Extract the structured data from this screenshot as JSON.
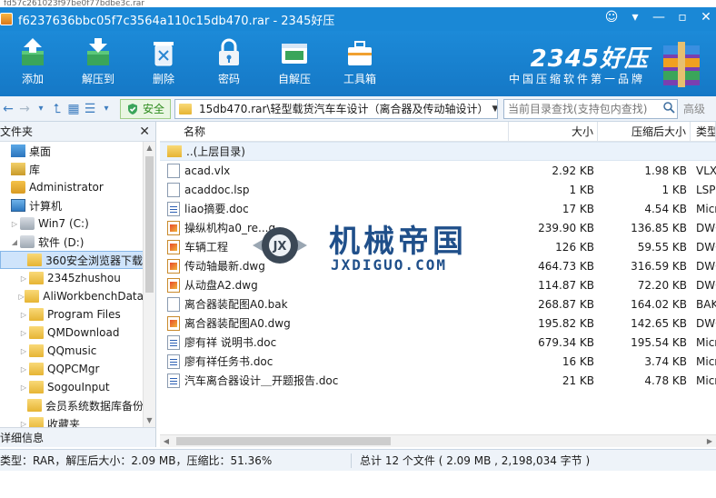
{
  "top_strip": "fd57c261023f97be0f77bdbe3c.rar",
  "window": {
    "title": "f6237636bbc05f7c3564a110c15db470.rar - 2345好压"
  },
  "toolbar": [
    {
      "label": "添加",
      "icon": "add-icon"
    },
    {
      "label": "解压到",
      "icon": "extract-icon"
    },
    {
      "label": "删除",
      "icon": "delete-icon"
    },
    {
      "label": "密码",
      "icon": "password-icon"
    },
    {
      "label": "自解压",
      "icon": "sfx-icon"
    },
    {
      "label": "工具箱",
      "icon": "toolbox-icon"
    }
  ],
  "brand": {
    "logo": "2345好压",
    "slogan": "中国压缩软件第一品牌"
  },
  "addressbar": {
    "safe_label": "安全",
    "path": "15db470.rar\\轻型载货汽车车设计（离合器及传动轴设计）",
    "search_placeholder": "当前目录查找(支持包内查找)",
    "advanced_label": "高级"
  },
  "left_pane": {
    "title": "文件夹",
    "close": "✕",
    "tree": [
      {
        "label": "桌面",
        "indent": 0,
        "icon": "desktop",
        "arrow": ""
      },
      {
        "label": "库",
        "indent": 0,
        "icon": "library",
        "arrow": ""
      },
      {
        "label": "Administrator",
        "indent": 0,
        "icon": "user",
        "arrow": ""
      },
      {
        "label": "计算机",
        "indent": 0,
        "icon": "computer",
        "arrow": ""
      },
      {
        "label": "Win7 (C:)",
        "indent": 1,
        "icon": "drive",
        "arrow": "▷"
      },
      {
        "label": "软件 (D:)",
        "indent": 1,
        "icon": "drive",
        "arrow": "◢"
      },
      {
        "label": "360安全浏览器下载",
        "indent": 2,
        "icon": "folder",
        "arrow": "",
        "selected": true
      },
      {
        "label": "2345zhushou",
        "indent": 2,
        "icon": "folder",
        "arrow": "▷"
      },
      {
        "label": "AliWorkbenchData",
        "indent": 2,
        "icon": "folder",
        "arrow": "▷"
      },
      {
        "label": "Program Files",
        "indent": 2,
        "icon": "folder",
        "arrow": "▷"
      },
      {
        "label": "QMDownload",
        "indent": 2,
        "icon": "folder",
        "arrow": "▷"
      },
      {
        "label": "QQmusic",
        "indent": 2,
        "icon": "folder",
        "arrow": "▷"
      },
      {
        "label": "QQPCMgr",
        "indent": 2,
        "icon": "folder",
        "arrow": "▷"
      },
      {
        "label": "SogouInput",
        "indent": 2,
        "icon": "folder",
        "arrow": "▷"
      },
      {
        "label": "会员系统数据库备份",
        "indent": 2,
        "icon": "folder",
        "arrow": ""
      },
      {
        "label": "收藏夹",
        "indent": 2,
        "icon": "folder",
        "arrow": "▷"
      }
    ]
  },
  "detail_pane_title": "详细信息",
  "file_list": {
    "columns": {
      "name": "名称",
      "size": "大小",
      "csize": "压缩后大小",
      "type": "类型"
    },
    "up_row": "..(上层目录)",
    "rows": [
      {
        "name": "acad.vlx",
        "size": "2.92 KB",
        "csize": "1.98 KB",
        "type": "VLX",
        "icon": "file"
      },
      {
        "name": "acaddoc.lsp",
        "size": "1 KB",
        "csize": "1 KB",
        "type": "LSP",
        "icon": "file"
      },
      {
        "name": "liao摘要.doc",
        "size": "17 KB",
        "csize": "4.54 KB",
        "type": "Micr",
        "icon": "doc"
      },
      {
        "name": "操纵机构a0_re...g",
        "size": "239.90 KB",
        "csize": "136.85 KB",
        "type": "DWG",
        "icon": "dwg"
      },
      {
        "name": "车辆工程",
        "size": "126 KB",
        "csize": "59.55 KB",
        "type": "DWG",
        "icon": "dwg"
      },
      {
        "name": "传动轴最新.dwg",
        "size": "464.73 KB",
        "csize": "316.59 KB",
        "type": "DWG",
        "icon": "dwg"
      },
      {
        "name": "从动盘A2.dwg",
        "size": "114.87 KB",
        "csize": "72.20 KB",
        "type": "DWG",
        "icon": "dwg"
      },
      {
        "name": "离合器装配图A0.bak",
        "size": "268.87 KB",
        "csize": "164.02 KB",
        "type": "BAK",
        "icon": "file"
      },
      {
        "name": "离合器装配图A0.dwg",
        "size": "195.82 KB",
        "csize": "142.65 KB",
        "type": "DWG",
        "icon": "dwg"
      },
      {
        "name": "廖有祥 说明书.doc",
        "size": "679.34 KB",
        "csize": "195.54 KB",
        "type": "Micr",
        "icon": "doc"
      },
      {
        "name": "廖有祥任务书.doc",
        "size": "16 KB",
        "csize": "3.74 KB",
        "type": "Micr",
        "icon": "doc"
      },
      {
        "name": "汽车离合器设计＿开题报告.doc",
        "size": "21 KB",
        "csize": "4.78 KB",
        "type": "Micr",
        "icon": "doc"
      }
    ]
  },
  "status": {
    "left": "类型：RAR，解压后大小：2.09 MB，压缩比：51.36%",
    "right": "总计 12 个文件 ( 2.09 MB , 2,198,034 字节 )"
  },
  "watermark": {
    "title": "机械帝国",
    "subtitle": "JXDIGUO.COM"
  },
  "colors": {
    "titlebar": "#1a88d6",
    "ribbon": "#1578c6",
    "selection": "#cfe4fb",
    "safe_green": "#2e8b1e"
  }
}
